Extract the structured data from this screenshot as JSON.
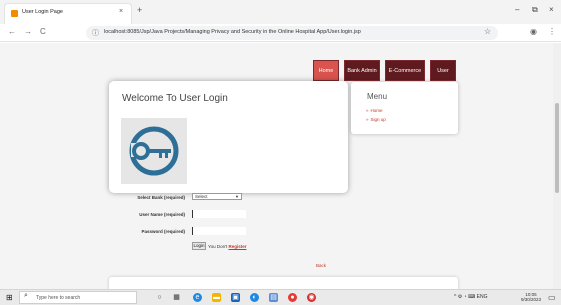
{
  "browser": {
    "tab_title": "User Login Page",
    "tab_close": "×",
    "new_tab": "+",
    "minimize": "–",
    "maximize": "⧉",
    "close": "×",
    "back": "←",
    "forward": "→",
    "reload": "C",
    "url": "localhost:8085/Jsp/Java Projects/Managing Privacy and Security in the Online Hospital App/User.login.jsp",
    "star_icon": "☆"
  },
  "nav": {
    "items": [
      {
        "label": "Home",
        "active": true
      },
      {
        "label": "Bank Admin",
        "active": false
      },
      {
        "label": "E-Commerce",
        "active": false
      },
      {
        "label": "User",
        "active": false
      }
    ]
  },
  "login_card": {
    "title": "Welcome To User Login"
  },
  "side_menu": {
    "title": "Menu",
    "links": [
      "Home",
      "Sign up"
    ]
  },
  "form": {
    "select_label": "Select Bank (required)",
    "select_value": "Select",
    "username_label": "User Name (required)",
    "password_label": "Password (required)",
    "login_button": "Login",
    "account_text": "You Don't",
    "register_link": "Register",
    "small_link": "Back"
  },
  "taskbar": {
    "search_placeholder": "Type here to search",
    "tray_text": "^ ⚙ ◔ ⌨ ENG",
    "time": "10:05",
    "date": "9/30/2023"
  },
  "colors": {
    "nav_dark": "#5e1a1f",
    "nav_active": "#d9534f",
    "link_red": "#c0392b",
    "key_blue": "#2e6f97"
  }
}
